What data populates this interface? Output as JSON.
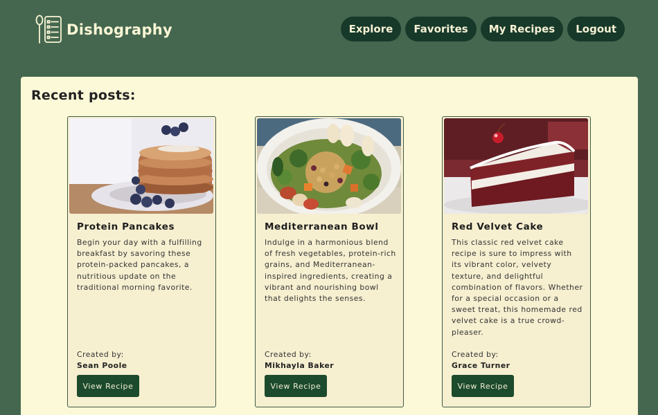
{
  "header": {
    "app_name": "Dishography",
    "logo_icon": "spoon-checklist-icon",
    "nav": [
      {
        "label": "Explore"
      },
      {
        "label": "Favorites"
      },
      {
        "label": "My Recipes"
      },
      {
        "label": "Logout"
      }
    ]
  },
  "main": {
    "section_title": "Recent posts:",
    "posts": [
      {
        "title": "Protein Pancakes",
        "description": "Begin your day with a fulfilling breakfast by savoring these protein-packed pancakes, a nutritious update on the traditional morning favorite.",
        "created_label": "Created by:",
        "author": "Sean Poole",
        "button_label": "View Recipe"
      },
      {
        "title": "Mediterranean Bowl",
        "description": "Indulge in a harmonious blend of fresh vegetables, protein-rich grains, and Mediterranean-inspired ingredients, creating a vibrant and nourishing bowl that delights the senses.",
        "created_label": "Created by:",
        "author": "Mikhayla Baker",
        "button_label": "View Recipe"
      },
      {
        "title": "Red Velvet Cake",
        "description": "This classic red velvet cake recipe is sure to impress with its vibrant color, velvety texture, and delightful combination of flavors. Whether for a special occasion or a sweet treat, this homemade red velvet cake is a true crowd-pleaser.",
        "created_label": "Created by:",
        "author": "Grace Turner",
        "button_label": "View Recipe"
      }
    ]
  },
  "colors": {
    "background": "#45674f",
    "nav_button": "#16392a",
    "panel": "#fcf9d8",
    "card": "#f6efd0",
    "view_button": "#1c4a2c"
  }
}
